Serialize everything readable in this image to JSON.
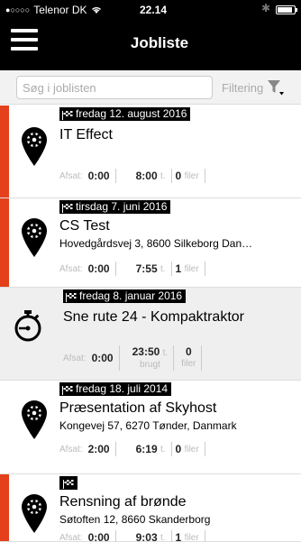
{
  "status": {
    "carrier": "Telenor DK",
    "signal_dots": "●○○○○",
    "time": "22.14",
    "bluetooth_icon": "bluetooth-icon"
  },
  "header": {
    "title": "Jobliste"
  },
  "search": {
    "placeholder": "Søg i joblisten",
    "filter_label": "Filtering"
  },
  "labels": {
    "afsat": "Afsat:",
    "t_unit": "t.",
    "filer": "filer",
    "brugt": "brugt"
  },
  "colors": {
    "accent": "#e4401c",
    "header_bg": "#000000",
    "muted": "#bbbbbb"
  },
  "jobs": [
    {
      "date": "fredag 12. august 2016",
      "title": "IT Effect",
      "address": "",
      "afsat": "0:00",
      "hours": "8:00",
      "files": "0",
      "icon": "map-pin-gear-icon",
      "bar": true
    },
    {
      "date": "tirsdag 7. juni 2016",
      "title": "CS Test",
      "address": "Hovedgårdsvej 3, 8600 Silkeborg Dan…",
      "afsat": "0:00",
      "hours": "7:55",
      "files": "1",
      "icon": "map-pin-gear-icon",
      "bar": true
    },
    {
      "date": "fredag 8. januar 2016",
      "title": "Sne rute 24 - Kompaktraktor",
      "address": "",
      "afsat": "0:00",
      "hours": "23:50",
      "files": "0",
      "icon": "stopwatch-icon",
      "bar": false
    },
    {
      "date": "fredag 18. juli 2014",
      "title": "Præsentation af Skyhost",
      "address": "Kongevej 57, 6270 Tønder, Danmark",
      "afsat": "2:00",
      "hours": "6:19",
      "files": "0",
      "icon": "map-pin-gear-icon",
      "bar": false
    },
    {
      "date": "",
      "title": "Rensning af brønde",
      "address": "Søtoften 12, 8660 Skanderborg",
      "afsat": "0:00",
      "hours": "9:03",
      "files": "1",
      "icon": "map-pin-gear-icon",
      "bar": true
    }
  ]
}
